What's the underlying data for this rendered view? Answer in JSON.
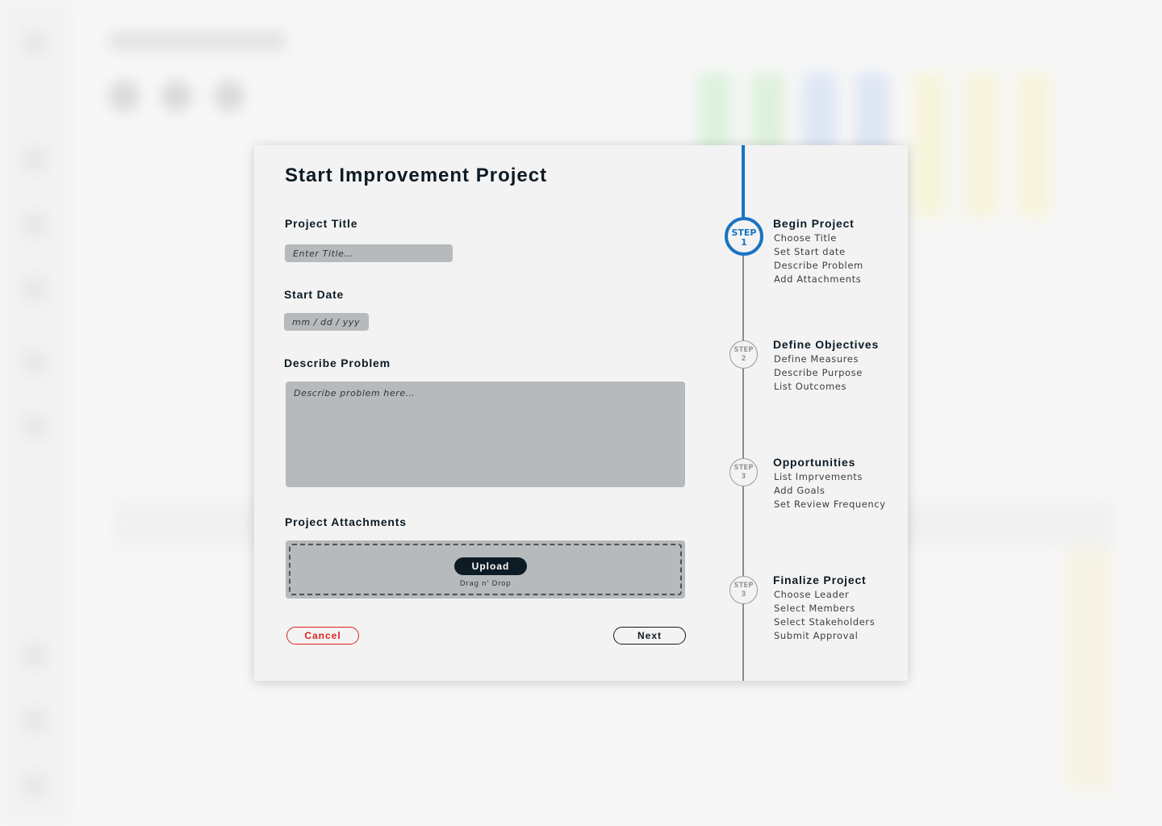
{
  "modal": {
    "title": "Start Improvement Project",
    "project_title": {
      "label": "Project Title",
      "placeholder": "Enter Title…"
    },
    "start_date": {
      "label": "Start Date",
      "placeholder": "mm / dd / yyy"
    },
    "describe_problem": {
      "label": "Describe Problem",
      "placeholder": "Describe problem here…"
    },
    "attachments": {
      "label": "Project Attachments",
      "upload_label": "Upload",
      "drag_text": "Drag n' Drop"
    },
    "cancel_label": "Cancel",
    "next_label": "Next"
  },
  "stepper": {
    "accent_color": "#1a73c4",
    "steps": [
      {
        "badge_word": "STEP",
        "badge_num": "1",
        "title": "Begin Project",
        "active": true,
        "items": [
          "Choose Title",
          "Set Start date",
          "Describe Problem",
          "Add Attachments"
        ]
      },
      {
        "badge_word": "STEP",
        "badge_num": "2",
        "title": "Define Objectives",
        "active": false,
        "items": [
          "Define Measures",
          "Describe Purpose",
          "List Outcomes"
        ]
      },
      {
        "badge_word": "STEP",
        "badge_num": "3",
        "title": "Opportunities",
        "active": false,
        "items": [
          "List Imprvements",
          "Add Goals",
          "Set Review Frequency"
        ]
      },
      {
        "badge_word": "STEP",
        "badge_num": "3",
        "title": "Finalize Project",
        "active": false,
        "items": [
          "Choose Leader",
          "Select Members",
          "Select Stakeholders",
          "Submit Approval"
        ]
      }
    ]
  },
  "colors": {
    "primary_dark": "#0d1b24",
    "cancel_red": "#e02020",
    "input_bg": "#b6babc"
  }
}
